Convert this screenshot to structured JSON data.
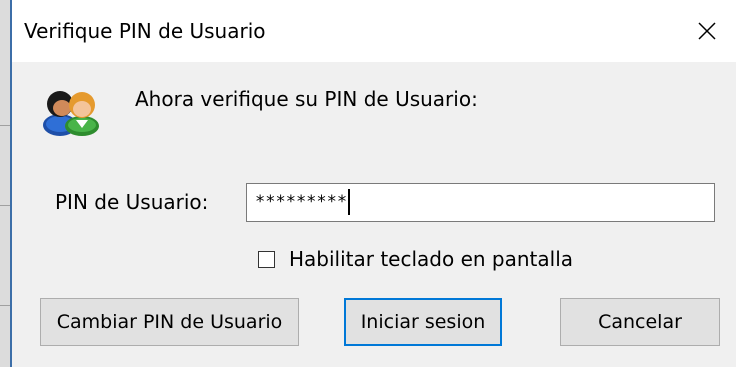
{
  "window": {
    "title": "Verifique PIN de Usuario",
    "close_symbol": "✕"
  },
  "icons": {
    "close": "close-icon",
    "users": "users-icon"
  },
  "prompt": {
    "text": "Ahora verifique su PIN de Usuario:"
  },
  "pin_field": {
    "label": "PIN de Usuario:",
    "value": "*********"
  },
  "onscreen_keyboard": {
    "label": "Habilitar teclado en pantalla",
    "checked": false
  },
  "buttons": {
    "change_pin": "Cambiar PIN de Usuario",
    "login": "Iniciar sesion",
    "cancel": "Cancelar"
  },
  "colors": {
    "focus_border": "#0078d7",
    "window_bg": "#f0f0f0",
    "title_bg": "#ffffff"
  }
}
